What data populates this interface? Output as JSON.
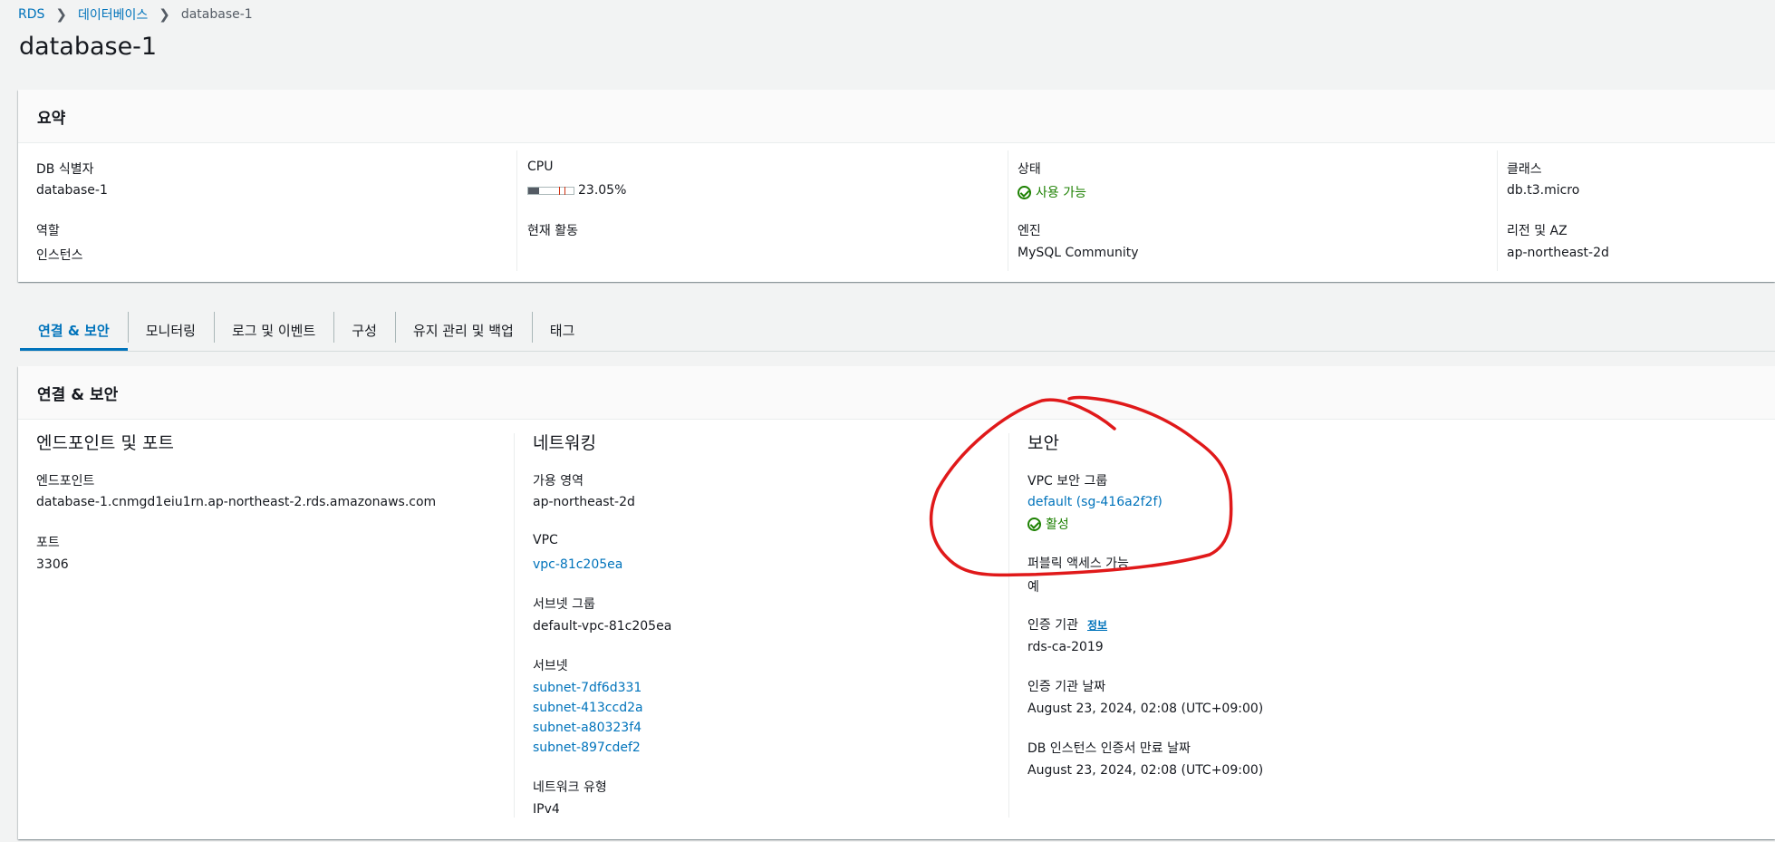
{
  "breadcrumb": {
    "root": "RDS",
    "databases": "데이터베이스",
    "current": "database-1"
  },
  "page_title": "database-1",
  "summary": {
    "title": "요약",
    "db_id": {
      "label": "DB 식별자",
      "value": "database-1"
    },
    "role": {
      "label": "역할",
      "value": "인스턴스"
    },
    "cpu": {
      "label": "CPU",
      "value": "23.05%",
      "percent": 23.05
    },
    "activity": {
      "label": "현재 활동"
    },
    "status": {
      "label": "상태",
      "value": "사용 가능"
    },
    "engine": {
      "label": "엔진",
      "value": "MySQL Community"
    },
    "class": {
      "label": "클래스",
      "value": "db.t3.micro"
    },
    "region": {
      "label": "리전 및 AZ",
      "value": "ap-northeast-2d"
    }
  },
  "tabs": [
    "연결 & 보안",
    "모니터링",
    "로그 및 이벤트",
    "구성",
    "유지 관리 및 백업",
    "태그"
  ],
  "conn": {
    "title": "연결 & 보안",
    "endpoint_section": {
      "title": "엔드포인트 및 포트",
      "endpoint_label": "엔드포인트",
      "endpoint_value": "database-1.cnmgd1eiu1rn.ap-northeast-2.rds.amazonaws.com",
      "port_label": "포트",
      "port_value": "3306"
    },
    "network_section": {
      "title": "네트워킹",
      "az_label": "가용 영역",
      "az_value": "ap-northeast-2d",
      "vpc_label": "VPC",
      "vpc_value": "vpc-81c205ea",
      "subnet_group_label": "서브넷 그룹",
      "subnet_group_value": "default-vpc-81c205ea",
      "subnets_label": "서브넷",
      "subnets": [
        "subnet-7df6d331",
        "subnet-413ccd2a",
        "subnet-a80323f4",
        "subnet-897cdef2"
      ],
      "network_type_label": "네트워크 유형",
      "network_type_value": "IPv4"
    },
    "security_section": {
      "title": "보안",
      "sg_label": "VPC 보안 그룹",
      "sg_value": "default (sg-416a2f2f)",
      "sg_status": "활성",
      "public_label": "퍼블릭 액세스 가능",
      "public_value": "예",
      "ca_label": "인증 기관",
      "ca_info": "정보",
      "ca_value": "rds-ca-2019",
      "ca_date_label": "인증 기관 날짜",
      "ca_date_value": "August 23, 2024, 02:08 (UTC+09:00)",
      "cert_expiry_label": "DB 인스턴스 인증서 만료 날짜",
      "cert_expiry_value": "August 23, 2024, 02:08 (UTC+09:00)"
    }
  },
  "colors": {
    "link": "#0073bb",
    "success": "#1d8102",
    "annotation": "#e0191a"
  }
}
